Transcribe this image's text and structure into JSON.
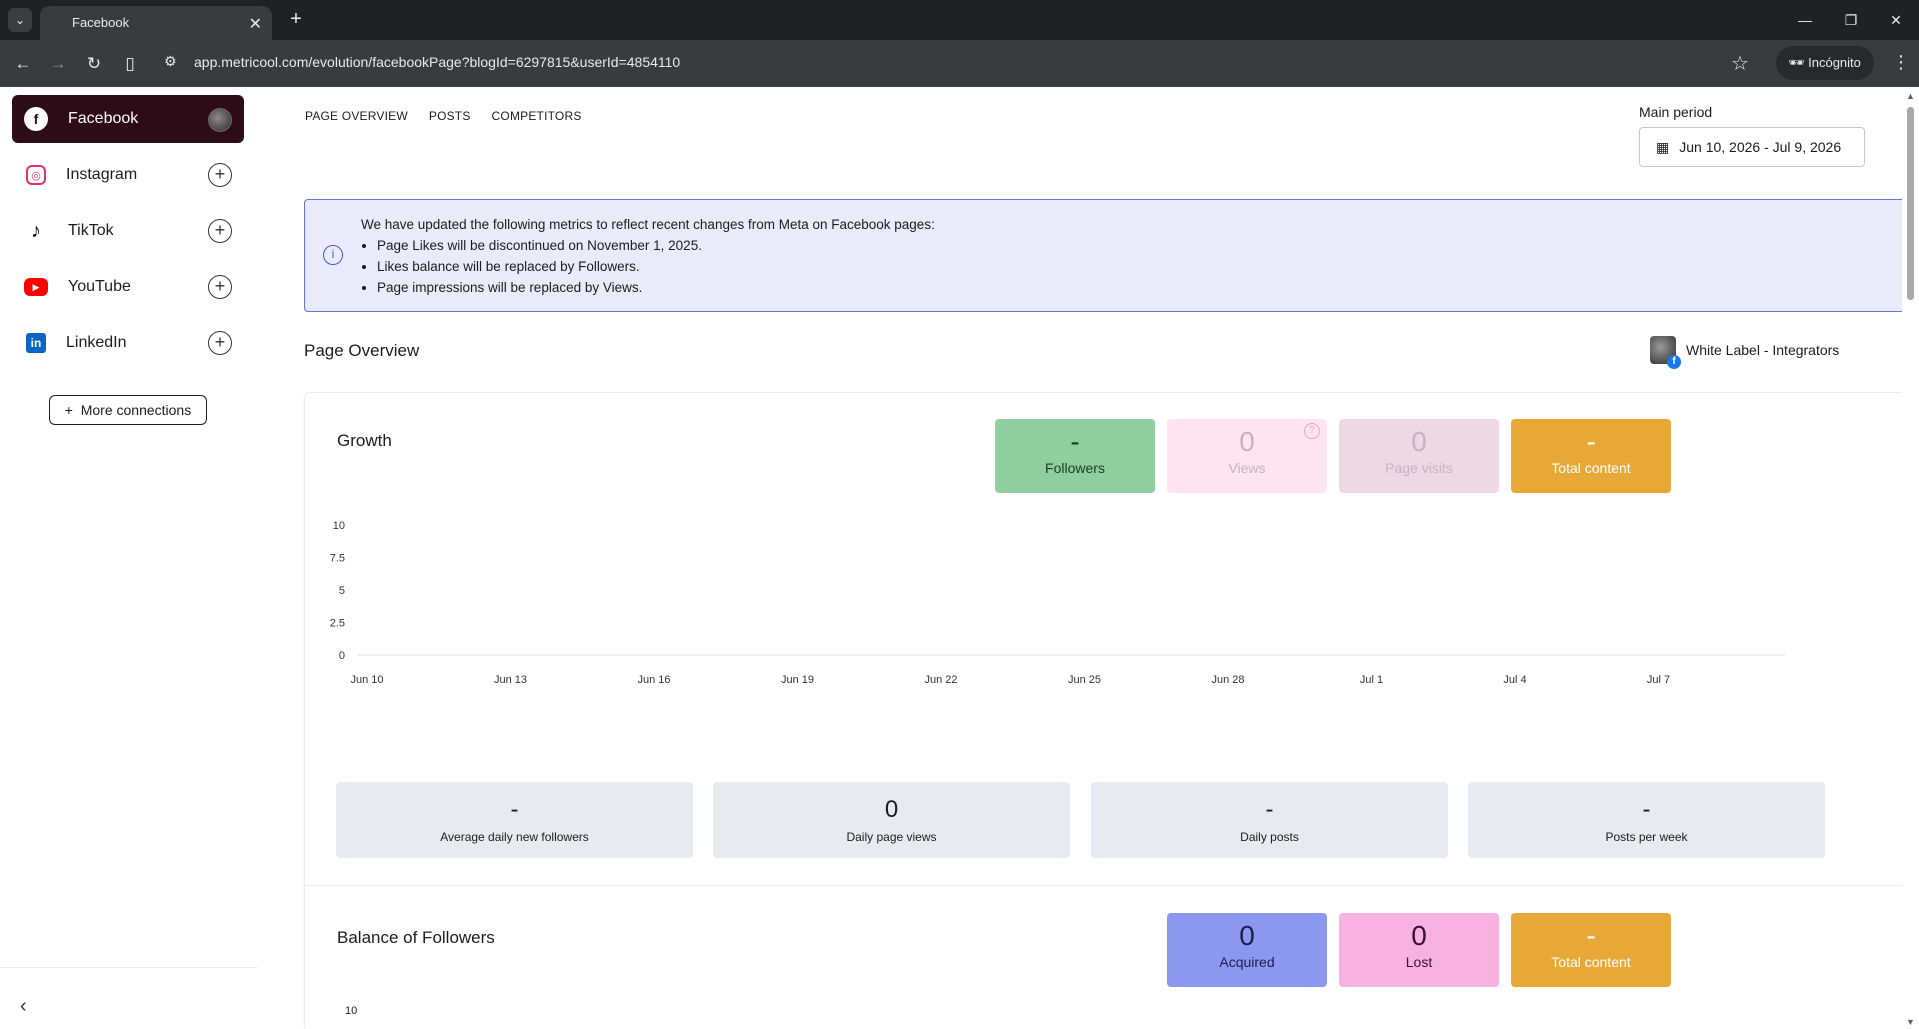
{
  "browser": {
    "tab_title": "Facebook",
    "url": "app.metricool.com/evolution/facebookPage?blogId=6297815&userId=4854110",
    "incognito_label": "Incógnito"
  },
  "sidebar": {
    "items": [
      {
        "label": "Facebook",
        "icon": "facebook-icon",
        "color": "#1877f2",
        "active": true
      },
      {
        "label": "Instagram",
        "icon": "instagram-icon",
        "color": "#e1306c"
      },
      {
        "label": "TikTok",
        "icon": "tiktok-icon",
        "color": "#000000"
      },
      {
        "label": "YouTube",
        "icon": "youtube-icon",
        "color": "#ff0000"
      },
      {
        "label": "LinkedIn",
        "icon": "linkedin-icon",
        "color": "#0a66c2"
      }
    ],
    "more_connections": "More connections"
  },
  "nav": {
    "tabs": [
      "PAGE OVERVIEW",
      "POSTS",
      "COMPETITORS"
    ]
  },
  "period": {
    "label": "Main period",
    "value": "Jun 10, 2026 - Jul 9, 2026"
  },
  "banner": {
    "intro": "We have updated the following metrics to reflect recent changes from Meta on Facebook pages:",
    "bullets": [
      "Page Likes will be discontinued on November 1, 2025.",
      "Likes balance will be replaced by Followers.",
      "Page impressions will be replaced by Views."
    ]
  },
  "overview": {
    "title": "Page Overview",
    "owner": "White Label - Integrators"
  },
  "growth": {
    "title": "Growth",
    "kpis": [
      {
        "value": "-",
        "label": "Followers",
        "bg": "#8fcf9f",
        "fg": "#1c3b26"
      },
      {
        "value": "0",
        "label": "Views",
        "bg": "#fde4f0",
        "fg": "#c9b0bd"
      },
      {
        "value": "0",
        "label": "Page visits",
        "bg": "#ecd9e3",
        "fg": "#c9b3c0"
      },
      {
        "value": "-",
        "label": "Total content",
        "bg": "#e8a838",
        "fg": "#ffffff"
      }
    ],
    "stats": [
      {
        "value": "-",
        "label": "Average daily new followers"
      },
      {
        "value": "0",
        "label": "Daily page views"
      },
      {
        "value": "-",
        "label": "Daily posts"
      },
      {
        "value": "-",
        "label": "Posts per week"
      }
    ]
  },
  "chart_data": {
    "type": "line",
    "title": "",
    "xlabel": "",
    "ylabel": "",
    "y_ticks": [
      "10",
      "7.5",
      "5",
      "2.5",
      "0"
    ],
    "ylim": [
      0,
      10
    ],
    "categories": [
      "Jun 10",
      "Jun 13",
      "Jun 16",
      "Jun 19",
      "Jun 22",
      "Jun 25",
      "Jun 28",
      "Jul 1",
      "Jul 4",
      "Jul 7"
    ],
    "series": []
  },
  "balance": {
    "title": "Balance of Followers",
    "kpis": [
      {
        "value": "0",
        "label": "Acquired",
        "bg": "#8c97f0",
        "fg": "#1c1f4a"
      },
      {
        "value": "0",
        "label": "Lost",
        "bg": "#f8b2e0",
        "fg": "#3d1030"
      },
      {
        "value": "-",
        "label": "Total content",
        "bg": "#e8a838",
        "fg": "#ffffff"
      }
    ],
    "y_tick_top": "10"
  }
}
